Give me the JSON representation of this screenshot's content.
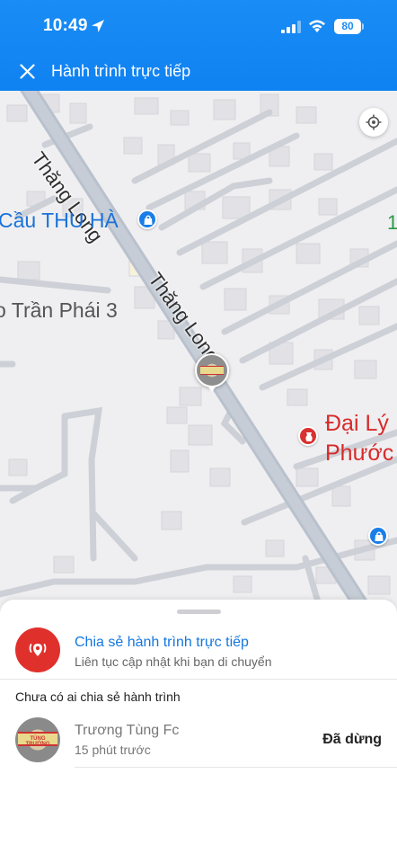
{
  "status_bar": {
    "time": "10:49",
    "battery": "80"
  },
  "header": {
    "title": "Hành trình trực tiếp"
  },
  "map": {
    "road_label_1": "Thăng Long",
    "road_label_2": "Thăng Long",
    "poi_cau_thu_ha": "Cầu THU HÀ",
    "poi_tran_phai": "o Trần Phái 3",
    "poi_dai_ly": "Đại Lý",
    "poi_phuoc": "Phước",
    "poi_edge": "1"
  },
  "sheet": {
    "share": {
      "title": "Chia sẻ hành trình trực tiếp",
      "subtitle": "Liên tục cập nhật khi bạn di chuyển"
    },
    "section_label": "Chưa có ai chia sẻ hành trình",
    "users": [
      {
        "name": "Trương Tùng Fc",
        "time": "15 phút trước",
        "status": "Đã dừng",
        "avatar_text": "TÙNG TRƯỜNG"
      }
    ]
  },
  "colors": {
    "header": "#0f82f2",
    "share_red": "#e0302c",
    "link_blue": "#1477e0",
    "map_bg": "#efeff1"
  }
}
